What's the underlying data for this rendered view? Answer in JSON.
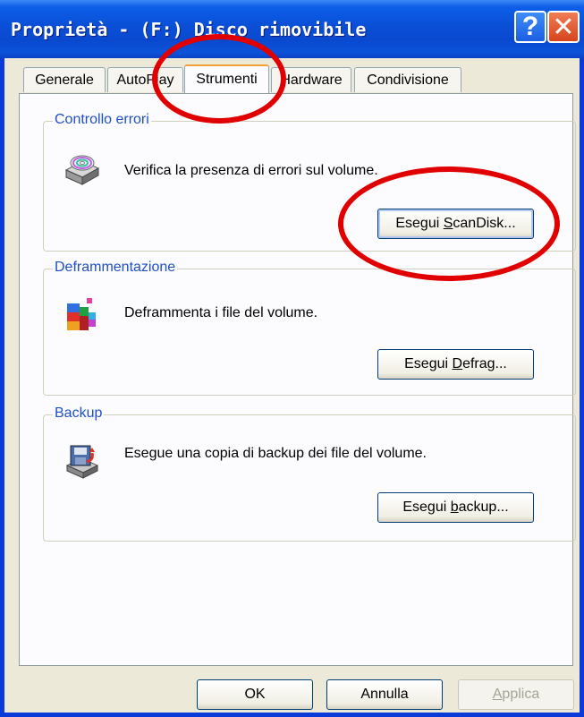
{
  "window": {
    "title": "Proprietà - (F:) Disco rimovibile"
  },
  "titlebar_buttons": {
    "help": "?",
    "close": "✕"
  },
  "tabs": [
    {
      "label": "Generale"
    },
    {
      "label": "AutoPlay"
    },
    {
      "label": "Strumenti"
    },
    {
      "label": "Hardware"
    },
    {
      "label": "Condivisione"
    }
  ],
  "groups": {
    "error_check": {
      "title": "Controllo errori",
      "description": "Verifica la presenza di errori sul volume.",
      "button_pre": "Esegui ",
      "button_key": "S",
      "button_post": "canDisk...",
      "icon": "disk-check-icon"
    },
    "defrag": {
      "title": "Deframmentazione",
      "description": "Deframmenta i file del volume.",
      "button_pre": "Esegui ",
      "button_key": "D",
      "button_post": "efrag...",
      "icon": "defrag-icon"
    },
    "backup": {
      "title": "Backup",
      "description": "Esegue una copia di backup dei file del volume.",
      "button_pre": "Esegui ",
      "button_key": "b",
      "button_post": "ackup...",
      "icon": "backup-icon"
    }
  },
  "footer": {
    "ok": "OK",
    "cancel": "Annulla",
    "apply_key": "A",
    "apply_post": "pplica"
  },
  "colors": {
    "titlebar": "#0a4fd6",
    "group_label": "#1f4fc8",
    "annotation": "#e00000",
    "tab_highlight": "#f0a238"
  }
}
